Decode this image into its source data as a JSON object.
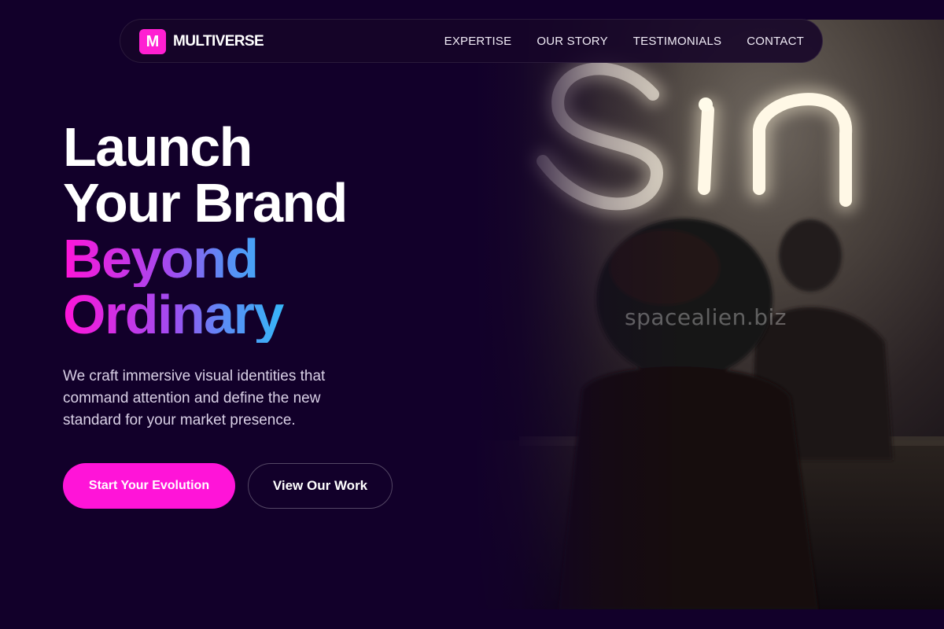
{
  "brand": {
    "logo_letter": "M",
    "name": "MULTIVERSE",
    "accent_color": "#ff14d8"
  },
  "nav": {
    "links": [
      {
        "label": "EXPERTISE"
      },
      {
        "label": "OUR STORY"
      },
      {
        "label": "TESTIMONIALS"
      },
      {
        "label": "CONTACT"
      }
    ]
  },
  "hero": {
    "headline": {
      "line1": "Launch",
      "line2": "Your Brand",
      "line3": "Beyond",
      "line4": "Ordinary"
    },
    "subcopy": "We craft immersive visual identities that command attention and define the new standard for your market presence.",
    "primary_cta": "Start Your Evolution",
    "secondary_cta": "View Our Work",
    "gradient_colors": [
      "#ff14d8",
      "#a04cf0",
      "#5b8cf5",
      "#1fd2fa"
    ]
  },
  "photo": {
    "neon_sign_text": "Sin",
    "watermark": "spacealien.biz"
  },
  "colors": {
    "background": "#12002a",
    "text": "#ffffff",
    "subtext": "#d9d0e6"
  }
}
